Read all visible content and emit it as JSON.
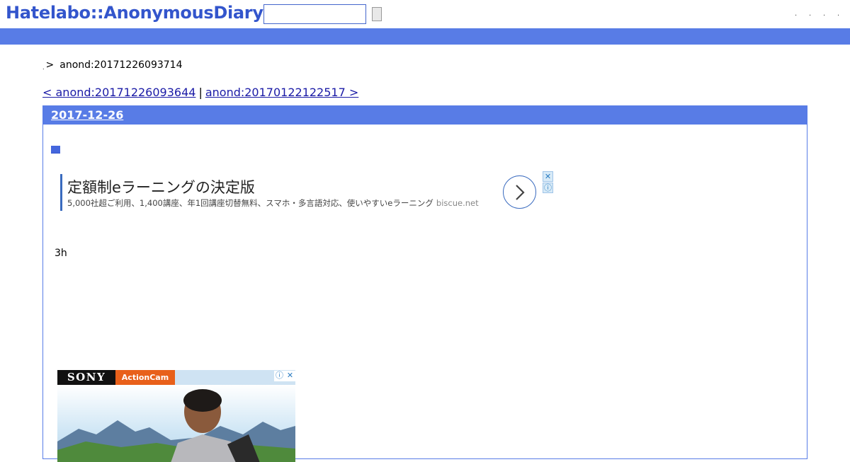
{
  "header": {
    "logo": "Hatelabo::AnonymousDiary",
    "search_placeholder": "",
    "search_button_label": "",
    "links": [
      ".",
      ".",
      ".",
      "."
    ]
  },
  "breadcrumb": {
    "home": ".",
    "separator": ">",
    "current": "anond:20171226093714"
  },
  "pager": {
    "prev": "< anond:20171226093644",
    "divider": "|",
    "next": "anond:20170122122517 >"
  },
  "day": {
    "date": "2017-12-26",
    "anchor": "■",
    "body": "3h"
  },
  "text_ad": {
    "title": "定額制eラーニングの決定版",
    "description": "5,000社超ご利用、1,400講座、年1回講座切替無料、スマホ・多言語対応、使いやすいeラーニング",
    "domain": "biscue.net"
  },
  "image_ad": {
    "brand": "SONY",
    "product": "ActionCam"
  },
  "colors": {
    "accent": "#587ce6",
    "link": "#1a1aa6",
    "logo": "#3355cc",
    "ad_accent": "#3a6bbf",
    "sony_orange": "#e8601a"
  }
}
